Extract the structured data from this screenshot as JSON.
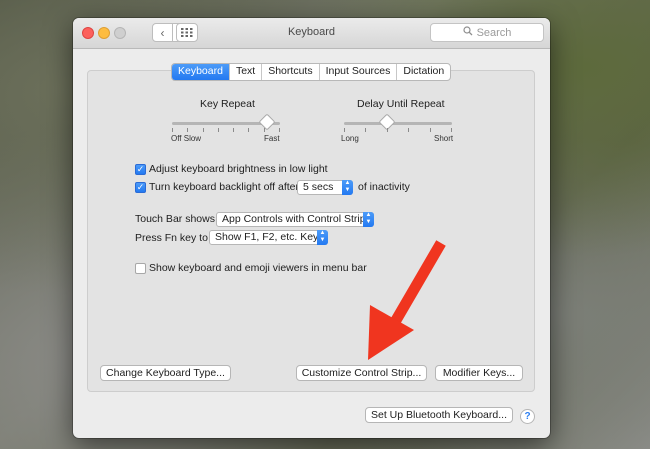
{
  "window": {
    "title": "Keyboard",
    "search_placeholder": "Search"
  },
  "tabs": [
    {
      "label": "Keyboard",
      "active": true
    },
    {
      "label": "Text",
      "active": false
    },
    {
      "label": "Shortcuts",
      "active": false
    },
    {
      "label": "Input Sources",
      "active": false
    },
    {
      "label": "Dictation",
      "active": false
    }
  ],
  "key_repeat": {
    "label": "Key Repeat",
    "min_labels": "Off  Slow",
    "max_label": "Fast",
    "value_fraction": 0.88
  },
  "delay_until_repeat": {
    "label": "Delay Until Repeat",
    "min_label": "Long",
    "max_label": "Short",
    "value_fraction": 0.4
  },
  "options": {
    "brightness_label": "Adjust keyboard brightness in low light",
    "brightness_checked": true,
    "backlight_label": "Turn keyboard backlight off after",
    "backlight_checked": true,
    "backlight_value": "5 secs",
    "backlight_suffix": "of inactivity",
    "touchbar_label": "Touch Bar shows",
    "touchbar_value": "App Controls with Control Strip",
    "fn_label": "Press Fn key to",
    "fn_value": "Show F1, F2, etc. Keys",
    "viewers_label": "Show keyboard and emoji viewers in menu bar",
    "viewers_checked": false
  },
  "buttons": {
    "change_type": "Change Keyboard Type...",
    "customize_strip": "Customize Control Strip...",
    "modifier_keys": "Modifier Keys...",
    "bluetooth": "Set Up Bluetooth Keyboard...",
    "help": "?"
  },
  "colors": {
    "accent": "#2379f1",
    "arrow": "#f0351f"
  }
}
